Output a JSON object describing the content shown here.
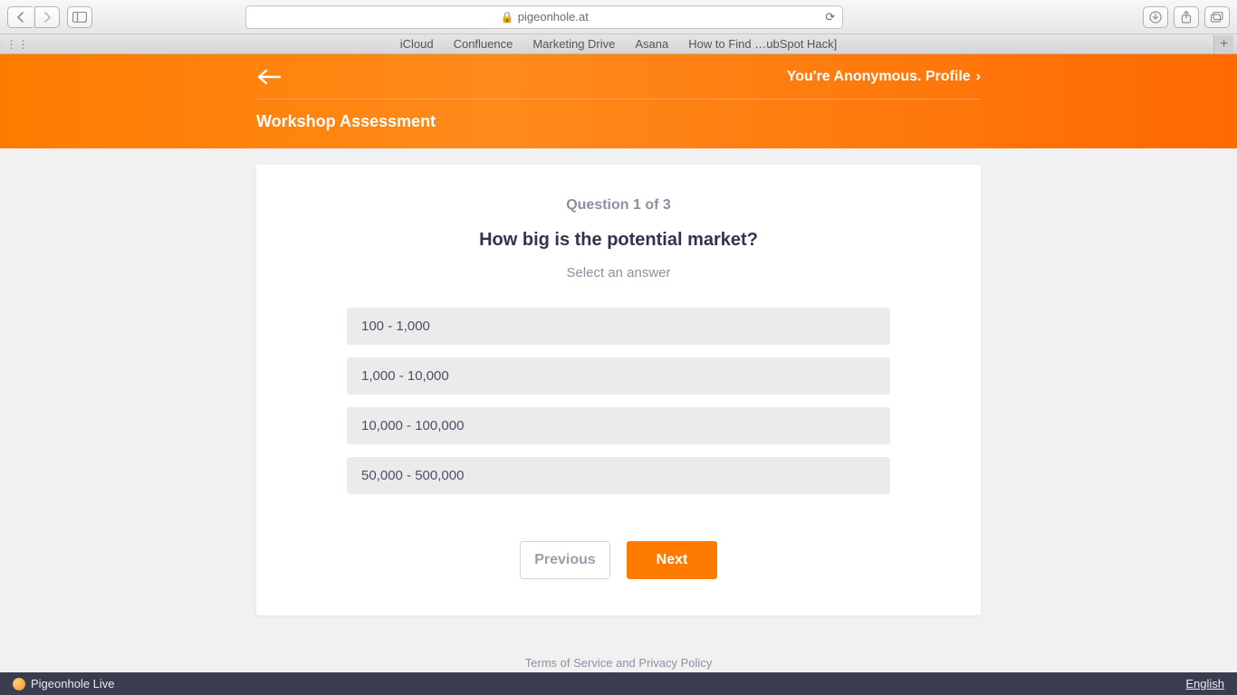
{
  "browser": {
    "domain": "pigeonhole.at",
    "bookmarks": [
      "iCloud",
      "Confluence",
      "Marketing Drive",
      "Asana",
      "How to Find …ubSpot Hack]"
    ]
  },
  "hero": {
    "profile_text": "You're Anonymous. Profile",
    "title": "Workshop Assessment"
  },
  "question": {
    "progress": "Question 1 of 3",
    "text": "How big is the potential market?",
    "help": "Select an answer",
    "answers": [
      "100 - 1,000",
      "1,000 - 10,000",
      "10,000 - 100,000",
      "50,000 - 500,000"
    ]
  },
  "nav": {
    "prev": "Previous",
    "next": "Next"
  },
  "legal": {
    "terms": "Terms of Service",
    "and": " and ",
    "privacy": "Privacy Policy"
  },
  "bottom": {
    "brand": "Pigeonhole Live",
    "language": "English"
  }
}
